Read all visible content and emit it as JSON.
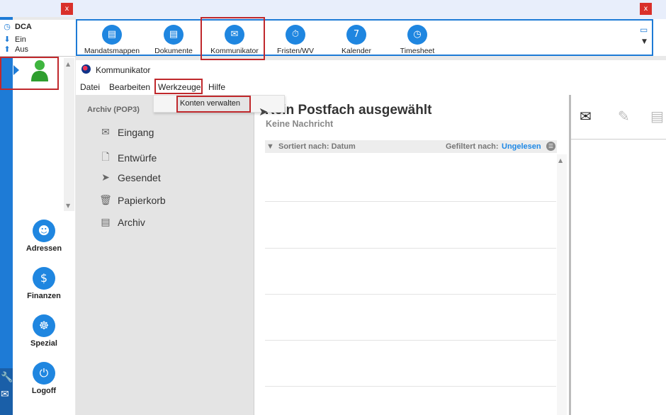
{
  "left_panel": {
    "close_label": "x",
    "dca": {
      "title": "DCA",
      "in_label": "Ein",
      "out_label": "Aus"
    },
    "nav": [
      {
        "label": "Adressen",
        "icon": "people-icon"
      },
      {
        "label": "Finanzen",
        "icon": "coins-icon"
      },
      {
        "label": "Spezial",
        "icon": "helm-icon"
      },
      {
        "label": "Logoff",
        "icon": "power-icon"
      }
    ]
  },
  "toolbar": {
    "close_label": "x",
    "buttons": [
      {
        "label": "Mandatsmappen",
        "icon": "briefcase-icon"
      },
      {
        "label": "Dokumente",
        "icon": "document-icon"
      },
      {
        "label": "Kommunikator",
        "icon": "envelope-icon"
      },
      {
        "label": "Fristen/WV",
        "icon": "stopwatch-icon"
      },
      {
        "label": "Kalender",
        "icon": "calendar-icon"
      },
      {
        "label": "Timesheet",
        "icon": "clock-icon"
      }
    ]
  },
  "window": {
    "title": "Kommunikator",
    "menu": [
      "Datei",
      "Bearbeiten",
      "Werkzeuge",
      "Hilfe"
    ],
    "dropdown_item": "Konten verwalten"
  },
  "folders": {
    "section": "Archiv (POP3)",
    "items": [
      "Eingang",
      "Entwürfe",
      "Gesendet",
      "Papierkorb",
      "Archiv"
    ]
  },
  "messages": {
    "heading": "Kein Postfach ausgewählt",
    "subheading": "Keine Nachricht",
    "sort_label": "Sortiert nach: Datum",
    "filter_label": "Gefiltert nach:",
    "filter_value": "Ungelesen"
  },
  "colors": {
    "accent": "#1e7bd6",
    "highlight": "#c0282c"
  }
}
